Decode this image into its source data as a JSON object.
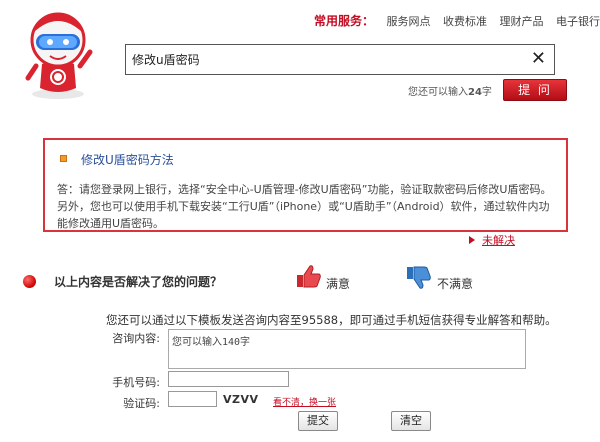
{
  "services": {
    "title": "常用服务：",
    "links": [
      "服务网点",
      "收费标准",
      "理财产品",
      "电子银行"
    ]
  },
  "search": {
    "value": "修改u盾密码",
    "remaining_prefix": "您还可以输入",
    "remaining_count": "24",
    "remaining_suffix": "字",
    "submit_label": "提 问"
  },
  "answer": {
    "title": "修改U盾密码方法",
    "text": "答：请您登录网上银行，选择“安全中心-U盾管理-修改U盾密码”功能，验证取款密码后修改U盾密码。另外，您也可以使用手机下载安装“工行U盾”（iPhone）或“U盾助手”（Android）软件，通过软件内功能修改通用U盾密码。",
    "unsolved_label": "未解决"
  },
  "feedback": {
    "question": "以上内容是否解决了您的问题？",
    "satisfied_label": "满意",
    "unsatisfied_label": "不满意"
  },
  "sms": {
    "note": "您还可以通过以下模板发送咨询内容至95588，即可通过手机短信获得专业解答和帮助。",
    "content_label": "咨询内容:",
    "content_placeholder": "您可以输入140字",
    "phone_label": "手机号码:",
    "captcha_label": "验证码:",
    "captcha_text": "VZVV",
    "captcha_refresh": "看不清，换一张",
    "submit_label": "提交",
    "clear_label": "清空"
  },
  "colors": {
    "accent": "#c30d23",
    "link": "#2a4f9a"
  },
  "icons": [
    "mascot-logo",
    "clear-icon",
    "thumbs-up-icon",
    "thumbs-down-icon"
  ]
}
